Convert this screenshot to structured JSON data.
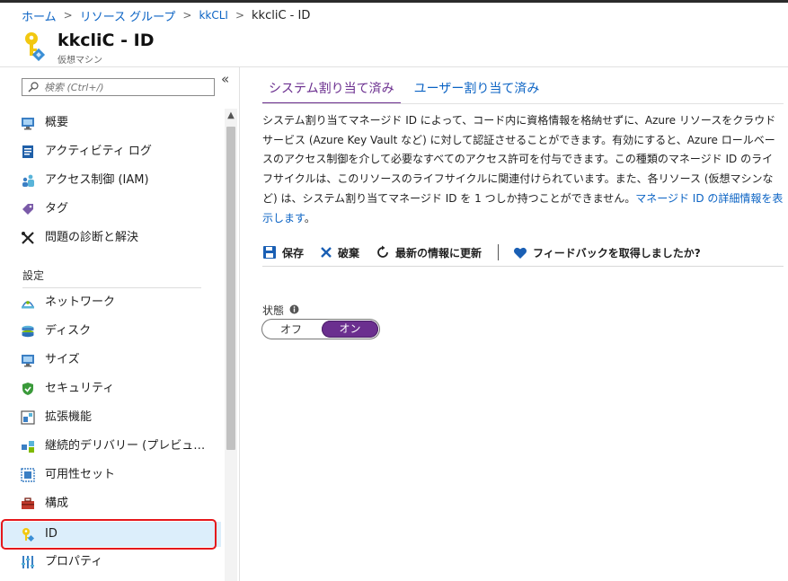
{
  "breadcrumb": {
    "items": [
      "ホーム",
      "リソース グループ",
      "kkCLI",
      "kkcliC - ID"
    ],
    "separator": ">"
  },
  "header": {
    "title": "kkcliC - ID",
    "subtitle": "仮想マシン",
    "icon": "key-icon"
  },
  "sidebar": {
    "search_placeholder": "検索 (Ctrl+/)",
    "collapse_glyph": "«",
    "section_settings": "設定",
    "items": [
      {
        "label": "概要",
        "icon": "monitor-icon"
      },
      {
        "label": "アクティビティ ログ",
        "icon": "log-icon"
      },
      {
        "label": "アクセス制御 (IAM)",
        "icon": "people-icon"
      },
      {
        "label": "タグ",
        "icon": "tag-icon"
      },
      {
        "label": "問題の診断と解決",
        "icon": "wrench-icon"
      },
      {
        "label": "ネットワーク",
        "icon": "network-icon"
      },
      {
        "label": "ディスク",
        "icon": "disk-icon"
      },
      {
        "label": "サイズ",
        "icon": "monitor-icon"
      },
      {
        "label": "セキュリティ",
        "icon": "shield-icon"
      },
      {
        "label": "拡張機能",
        "icon": "extensions-icon"
      },
      {
        "label": "継続的デリバリー (プレビュー)",
        "icon": "delivery-icon"
      },
      {
        "label": "可用性セット",
        "icon": "availability-icon"
      },
      {
        "label": "構成",
        "icon": "toolbox-icon"
      },
      {
        "label": "ID",
        "icon": "key-icon"
      },
      {
        "label": "プロパティ",
        "icon": "properties-icon"
      }
    ],
    "active_item": "ID"
  },
  "tabs": [
    {
      "label": "システム割り当て済み",
      "active": true
    },
    {
      "label": "ユーザー割り当て済み",
      "active": false
    }
  ],
  "description": {
    "text": "システム割り当てマネージド ID によって、コード内に資格情報を格納せずに、Azure リソースをクラウド サービス (Azure Key Vault など) に対して認証させることができます。有効にすると、Azure ロールベースのアクセス制御を介して必要なすべてのアクセス許可を付与できます。この種類のマネージド ID のライフサイクルは、このリソースのライフサイクルに関連付けられています。また、各リソース (仮想マシンなど) は、システム割り当てマネージド ID を 1 つしか持つことができません。",
    "link": "マネージド ID の詳細情報を表示します",
    "link_suffix": "。"
  },
  "toolbar": {
    "save": "保存",
    "discard": "破棄",
    "refresh": "最新の情報に更新",
    "feedback": "フィードバックを取得しましたか?"
  },
  "status": {
    "label": "状態",
    "off": "オフ",
    "on": "オン",
    "value": "オン"
  },
  "colors": {
    "accent": "#6b2f8f",
    "link": "#0b63c4",
    "active_bg": "#dceefb",
    "highlight_border": "#e5171b"
  }
}
